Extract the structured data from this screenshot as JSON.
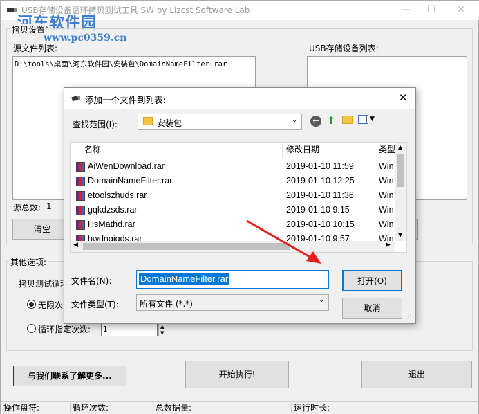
{
  "window": {
    "title": "USB存储设备循环拷贝测试工具 SW   by Lizcst Software Lab",
    "watermark": "河东软件园",
    "watermark_url": "www.pc0359.cn"
  },
  "copy_settings": {
    "group_label": "拷贝设置",
    "source_list_label": "源文件列表:",
    "source_file": "D:\\tools\\桌面\\河东软件园\\安装包\\DomainNameFilter.rar",
    "usb_list_label": "USB存储设备列表:",
    "source_total_label": "源总数:",
    "source_total": "1",
    "clear_button": "清空"
  },
  "other_options": {
    "group_label": "其他选项:",
    "copy_test_label": "拷贝测试循环",
    "unlimited_label": "无限次",
    "loop_count_label": "循环指定次数:",
    "loop_count_value": "1"
  },
  "actions": {
    "contact_button": "与我们联系了解更多...",
    "start_button": "开始执行!",
    "exit_button": "退出"
  },
  "status_bar": {
    "drive": "操作盘符:",
    "loops": "循环次数:",
    "total_data": "总数据量:",
    "runtime": "运行时长:"
  },
  "dialog": {
    "title": "添加一个文件到列表:",
    "look_in_label": "查找范围(I):",
    "look_in_value": "安装包",
    "columns": {
      "name": "名称",
      "modified": "修改日期",
      "type": "类型"
    },
    "files": [
      {
        "name": "AiWenDownload.rar",
        "modified": "2019-01-10 11:59",
        "type": "Win"
      },
      {
        "name": "DomainNameFilter.rar",
        "modified": "2019-01-10 12:25",
        "type": "Win"
      },
      {
        "name": "etoolszhuds.rar",
        "modified": "2019-01-10 11:36",
        "type": "Win"
      },
      {
        "name": "gqkdzsds.rar",
        "modified": "2019-01-10 9:15",
        "type": "Win"
      },
      {
        "name": "HsMathd.rar",
        "modified": "2019-01-10 10:15",
        "type": "Win"
      },
      {
        "name": "hwdngjqds.rar",
        "modified": "2019-01-10 9:57",
        "type": "Win"
      }
    ],
    "filename_label": "文件名(N):",
    "filename_value": "DomainNameFilter.rar",
    "filetype_label": "文件类型(T):",
    "filetype_value": "所有文件  (*.*)",
    "open_button": "打开(O)",
    "cancel_button": "取消"
  },
  "colors": {
    "watermark": "#3a7fcf",
    "selection": "#0078d7",
    "arrow": "#e52020"
  }
}
